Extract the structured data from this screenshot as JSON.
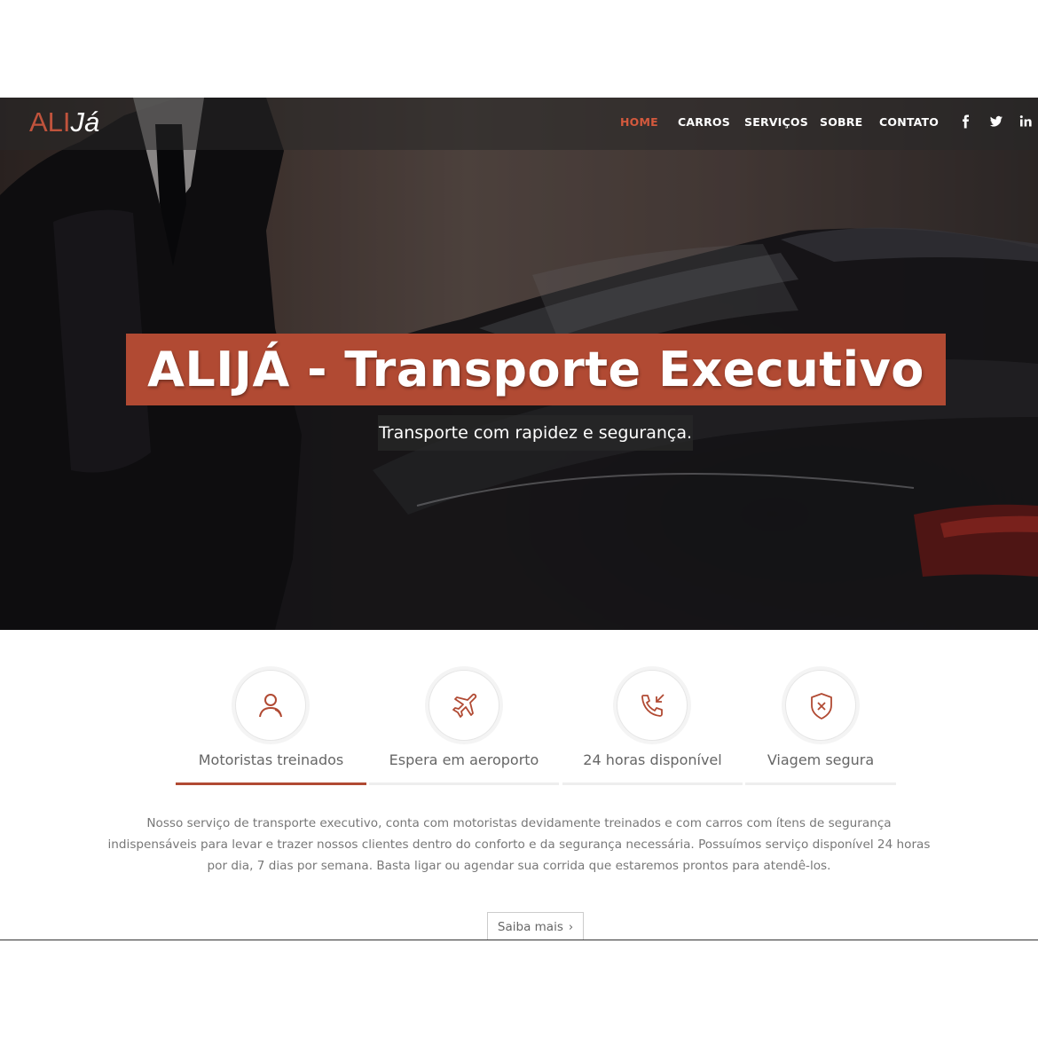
{
  "logo": {
    "part1": "ALI",
    "part2": "Já"
  },
  "nav": {
    "items": [
      {
        "label": "HOME",
        "active": true
      },
      {
        "label": "CARROS",
        "active": false
      },
      {
        "label": "SERVIÇOS",
        "active": false
      },
      {
        "label": "SOBRE",
        "active": false
      },
      {
        "label": "CONTATO",
        "active": false
      }
    ],
    "social": [
      "facebook-icon",
      "twitter-icon",
      "linkedin-icon"
    ]
  },
  "hero": {
    "title": "ALIJÁ - Transporte Executivo",
    "subtitle": "Transporte com rapidez e segurança."
  },
  "features": {
    "items": [
      {
        "label": "Motoristas treinados",
        "icon": "user-icon",
        "active": true
      },
      {
        "label": "Espera em aeroporto",
        "icon": "airplane-icon",
        "active": false
      },
      {
        "label": "24 horas disponível",
        "icon": "phone-incoming-icon",
        "active": false
      },
      {
        "label": "Viagem segura",
        "icon": "shield-icon",
        "active": false
      }
    ],
    "description": "Nosso serviço de transporte executivo, conta com motoristas devidamente treinados e com carros com ítens de segurança indispensáveis para levar e trazer nossos clientes dentro do conforto e da segurança necessária. Possuímos serviço disponível 24 horas por dia, 7 dias por semana. Basta ligar ou agendar sua corrida que estaremos prontos para atendê-los.",
    "more_label": "Saiba mais"
  },
  "colors": {
    "accent": "#b14a33",
    "nav_active": "#d4593d",
    "text": "#777777"
  }
}
